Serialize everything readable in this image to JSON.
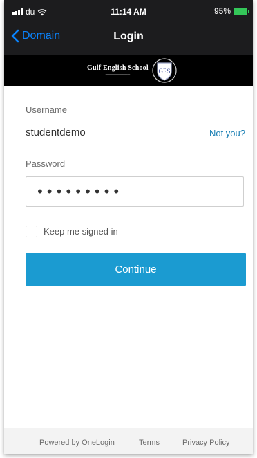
{
  "status_bar": {
    "carrier": "du",
    "time": "11:14 AM",
    "battery": "95%"
  },
  "nav": {
    "back_label": "Domain",
    "title": "Login"
  },
  "banner": {
    "school_name": "Gulf English School",
    "crest_text": "GES"
  },
  "form": {
    "username_label": "Username",
    "username_value": "studentdemo",
    "not_you_link": "Not you?",
    "password_label": "Password",
    "password_value": "•••••••••",
    "keep_signed_in_label": "Keep me signed in",
    "continue_label": "Continue"
  },
  "footer": {
    "powered_by": "Powered by OneLogin",
    "terms": "Terms",
    "privacy": "Privacy Policy"
  },
  "colors": {
    "accent": "#1b9bd1",
    "link": "#1a7fb4",
    "nav_back": "#0a84ff",
    "battery": "#34c759"
  }
}
